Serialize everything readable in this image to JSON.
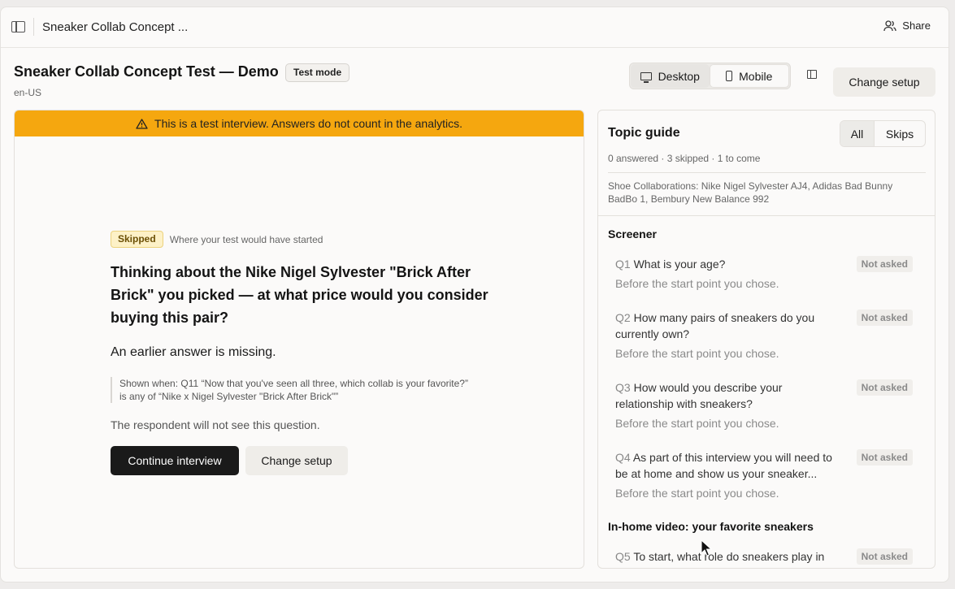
{
  "topbar": {
    "title": "Sneaker Collab Concept ...",
    "share_label": "Share"
  },
  "header": {
    "title": "Sneaker Collab Concept Test — Demo",
    "badge": "Test mode",
    "locale": "en-US",
    "device_options": [
      "Desktop",
      "Mobile"
    ],
    "selected_device": "Desktop",
    "change_setup_label": "Change setup"
  },
  "interview": {
    "warning": "This is a test interview. Answers do not count in the analytics.",
    "skipped_badge": "Skipped",
    "skip_note": "Where your test would have started",
    "question": "Thinking about the Nike Nigel Sylvester \"Brick After Brick\" you picked — at what price would you consider buying this pair?",
    "missing_answer": "An earlier answer is missing.",
    "shown_when": "Shown when: Q11 “Now that you've seen all three, which collab is your favorite?” is any of “Nike x Nigel Sylvester \"Brick After Brick\"”",
    "respondent_note": "The respondent will not see this question.",
    "continue_label": "Continue interview",
    "change_setup_label": "Change setup"
  },
  "guide": {
    "title": "Topic guide",
    "filters": [
      "All",
      "Skips"
    ],
    "selected_filter": "All",
    "stats": "0 answered · 3 skipped · 1 to come",
    "description": "Shoe Collaborations: Nike Nigel Sylvester AJ4, Adidas Bad Bunny BadBo 1, Bembury New Balance 992",
    "sections": [
      {
        "title": "Screener",
        "questions": [
          {
            "num": "Q1",
            "text": "What is your age?",
            "status": "Not asked",
            "note": "Before the start point you chose."
          },
          {
            "num": "Q2",
            "text": "How many pairs of sneakers do you currently own?",
            "status": "Not asked",
            "note": "Before the start point you chose."
          },
          {
            "num": "Q3",
            "text": "How would you describe your relationship with sneakers?",
            "status": "Not asked",
            "note": "Before the start point you chose."
          },
          {
            "num": "Q4",
            "text": "As part of this interview you will need to be at home and show us your sneaker...",
            "status": "Not asked",
            "note": "Before the start point you chose."
          }
        ]
      },
      {
        "title": "In-home video: your favorite sneakers",
        "questions": [
          {
            "num": "Q5",
            "text": "To start, what role do sneakers play in your life?",
            "status": "Not asked",
            "note": ""
          }
        ]
      }
    ]
  },
  "colors": {
    "warning_bg": "#f5a70f",
    "primary_button": "#1a1a1a",
    "skipped_badge_bg": "#fdf1c7"
  }
}
